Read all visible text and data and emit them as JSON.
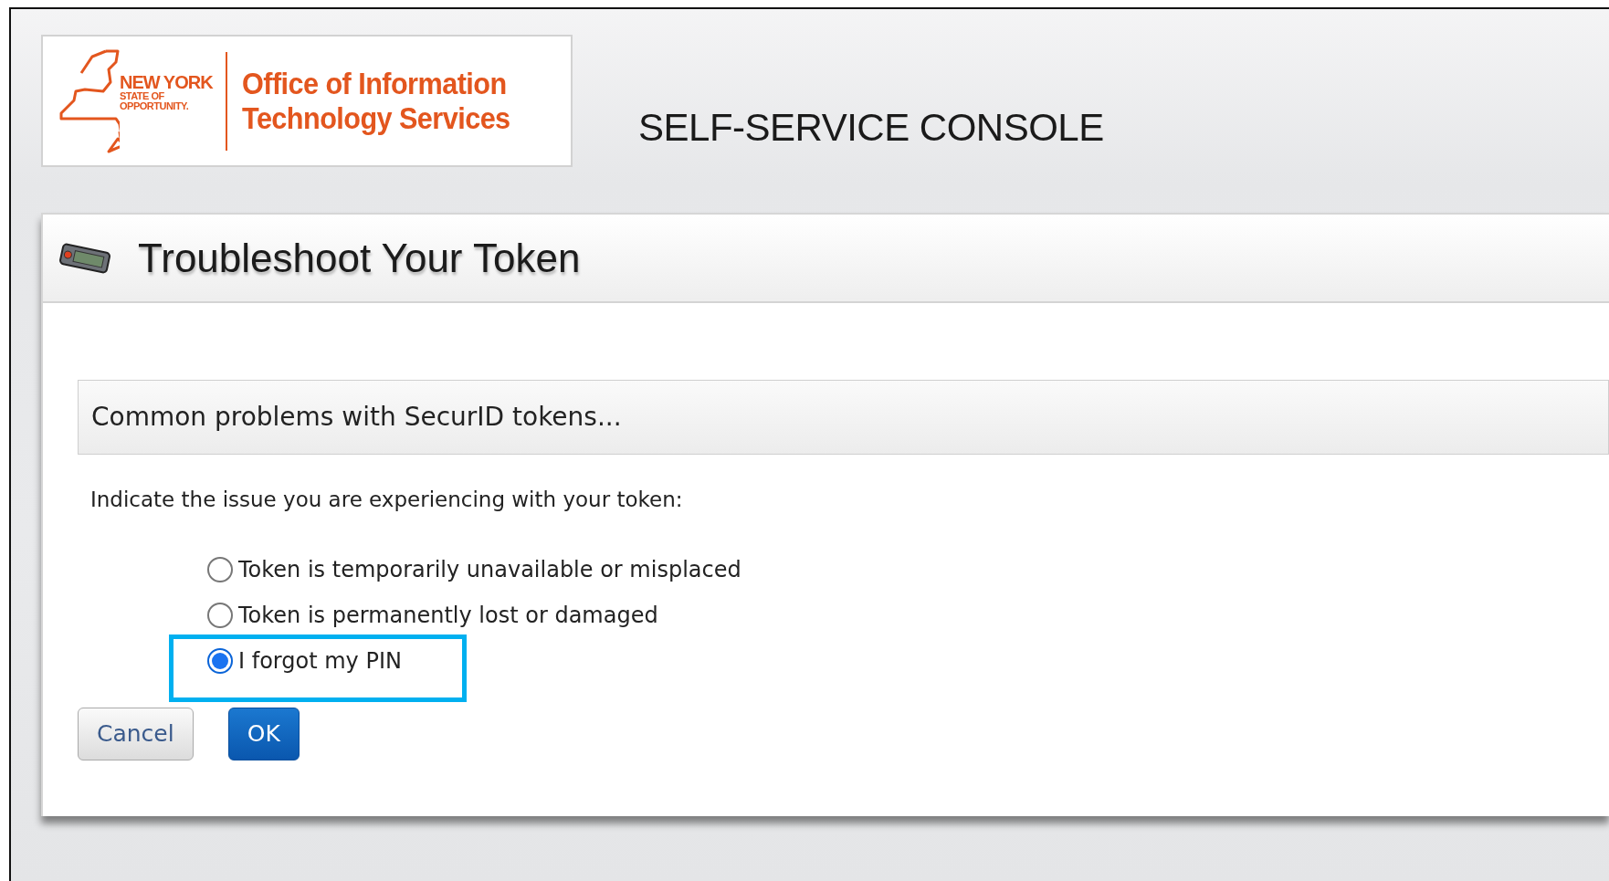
{
  "header": {
    "logo": {
      "state_lines": [
        "NEW YORK",
        "STATE OF",
        "OPPORTUNITY."
      ],
      "office_lines": [
        "Office of Information",
        "Technology Services"
      ]
    },
    "console_title": "SELF-SERVICE CONSOLE"
  },
  "panel": {
    "title": "Troubleshoot Your Token",
    "section_title": "Common problems with SecurID tokens...",
    "instruction": "Indicate the issue you are experiencing with your token:",
    "options": [
      {
        "label": "Token is temporarily unavailable or misplaced",
        "selected": false,
        "highlighted": false
      },
      {
        "label": "Token is permanently lost or damaged",
        "selected": false,
        "highlighted": false
      },
      {
        "label": "I forgot my PIN",
        "selected": true,
        "highlighted": true
      }
    ],
    "buttons": [
      {
        "label": "Cancel",
        "kind": "secondary"
      },
      {
        "label": "OK",
        "kind": "primary"
      }
    ]
  }
}
